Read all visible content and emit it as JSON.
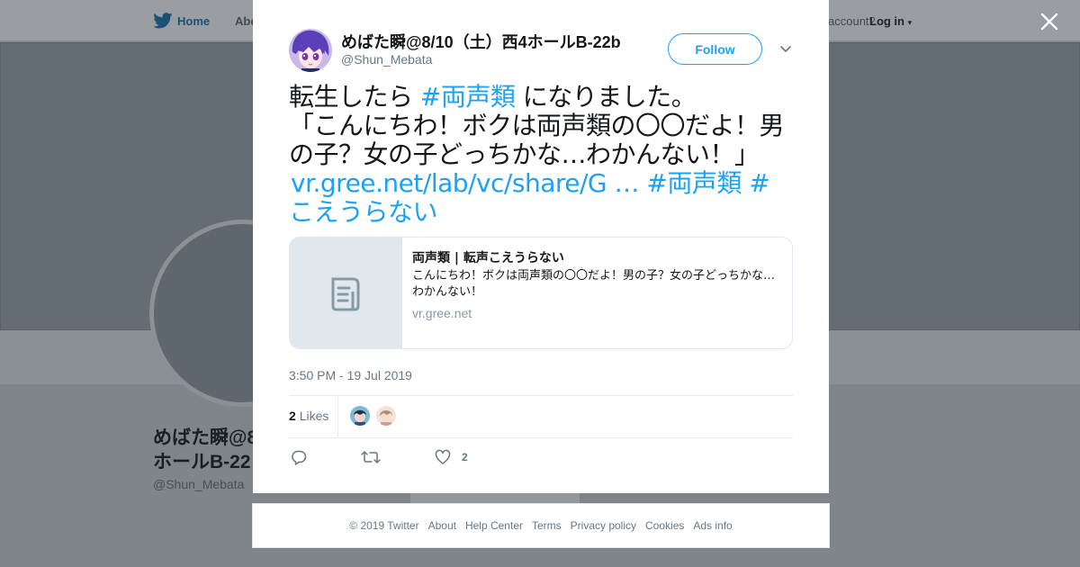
{
  "background": {
    "nav": {
      "home_label": "Home",
      "about_label": "Abo",
      "account_text": "account?",
      "login_label": "Log in"
    },
    "profile": {
      "name_line1": "めばた瞬@8",
      "name_line2": "ホールB-22",
      "handle": "@Shun_Mebata"
    }
  },
  "tweet": {
    "user": {
      "display_name": "めばた瞬@8/10（土）西4ホールB-22b",
      "handle": "@Shun_Mebata"
    },
    "follow_label": "Follow",
    "text": {
      "part1": "転生したら ",
      "hashtag1": "#両声類",
      "part2": " になりました。",
      "line2": "「こんにちわ！ボクは両声類の〇〇だよ！男の子？女の子どっちかな…わかんない！」",
      "link": "vr.gree.net/lab/vc/share/G …",
      "hashtag2": "#両声類",
      "hashtag3": "#こえうらない"
    },
    "card": {
      "title": "両声類 | 転声こえうらない",
      "description": "こんにちわ！ボクは両声類の〇〇だよ！男の子？女の子どっちかな…わかんない！",
      "domain": "vr.gree.net"
    },
    "timestamp": "3:50 PM - 19 Jul 2019",
    "likes": {
      "count": "2",
      "label": "Likes"
    },
    "actions": {
      "like_count": "2"
    }
  },
  "footer": {
    "copyright": "© 2019 Twitter",
    "links": [
      "About",
      "Help Center",
      "Terms",
      "Privacy policy",
      "Cookies",
      "Ads info"
    ]
  },
  "colors": {
    "accent": "#1da1f2",
    "text": "#14171a",
    "muted": "#657786",
    "overlay": "#7f858b"
  }
}
